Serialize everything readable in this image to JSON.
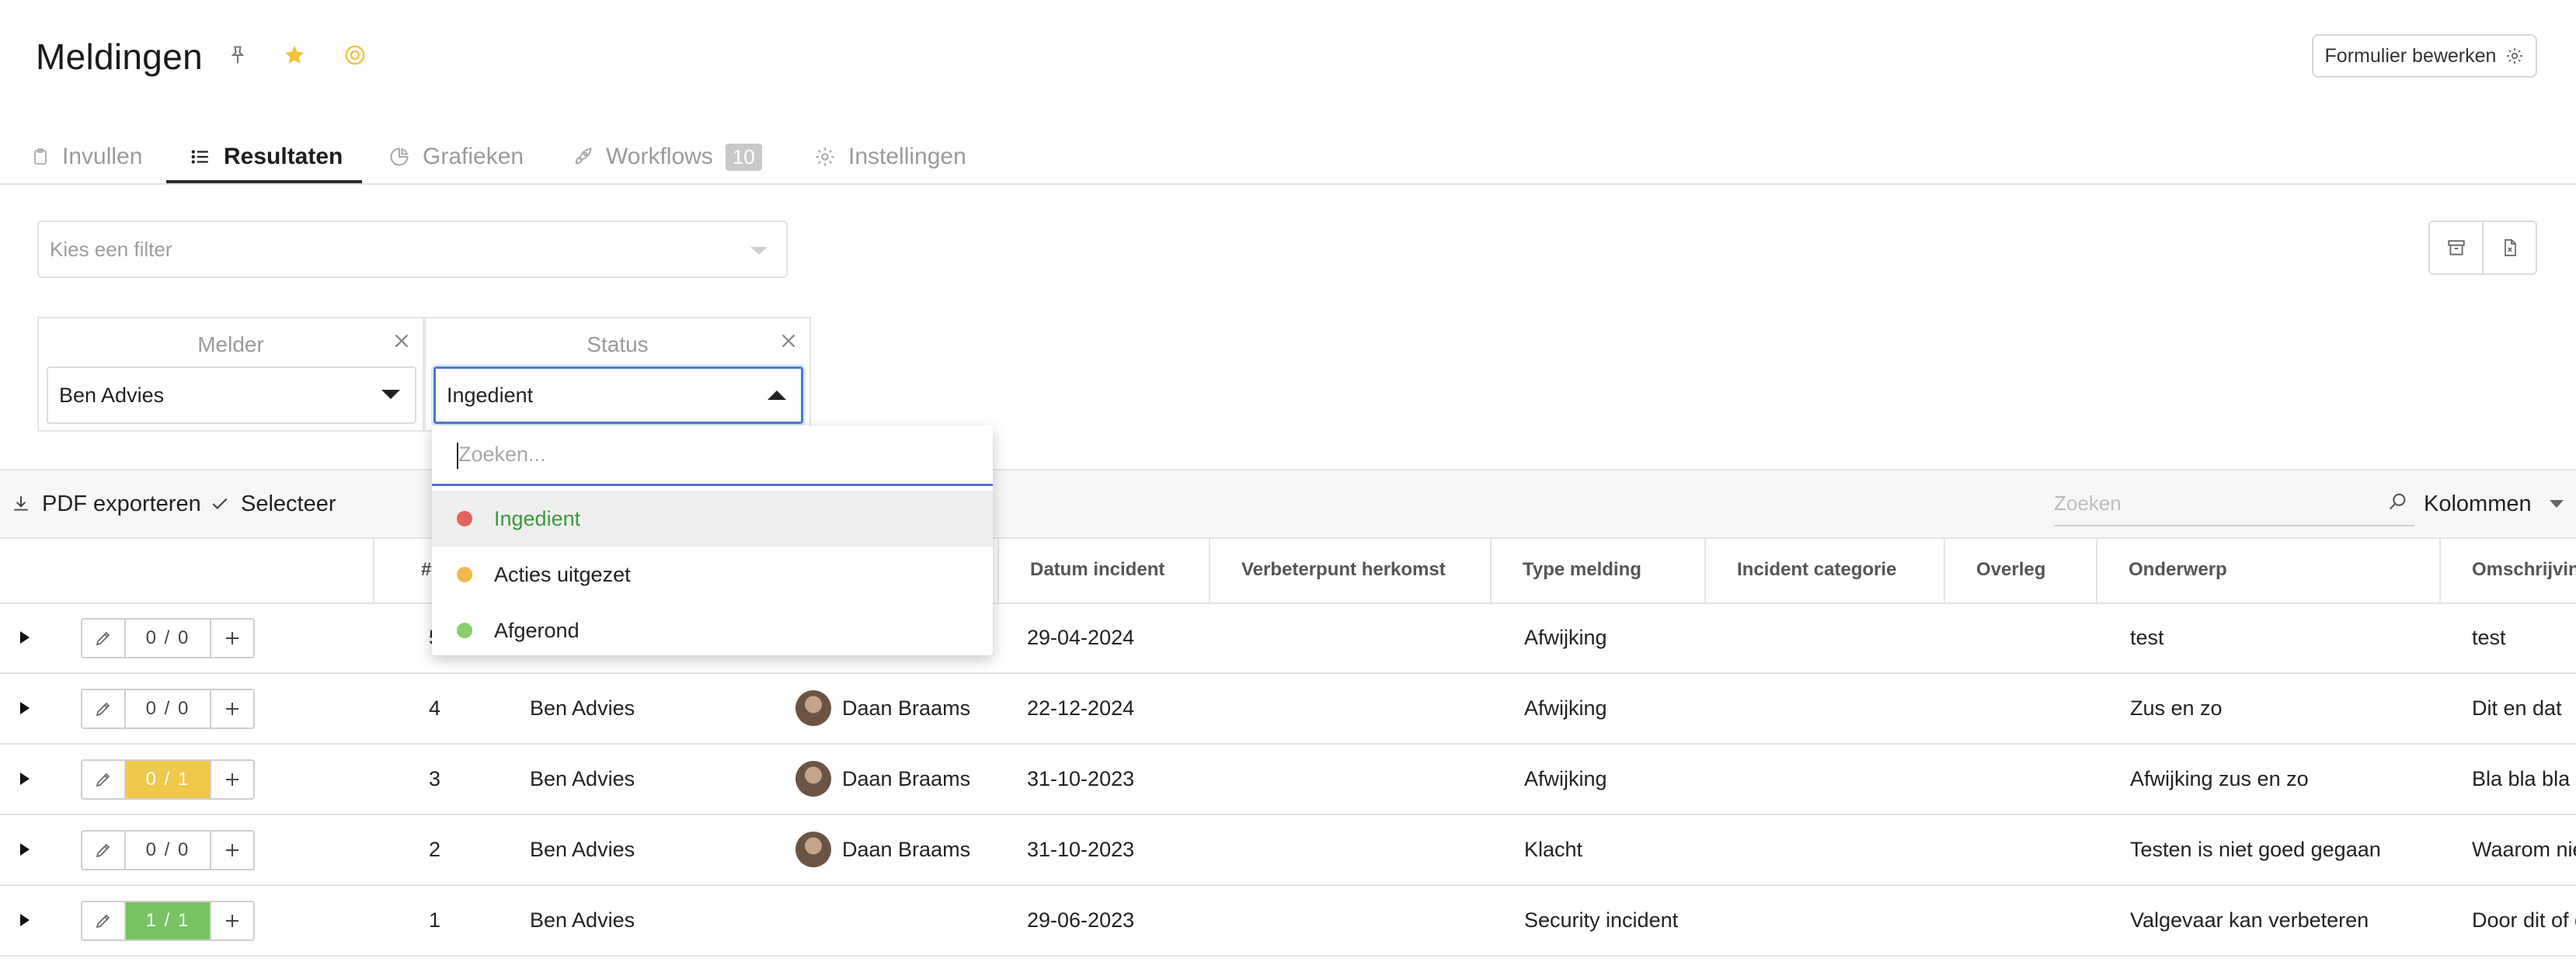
{
  "header": {
    "title": "Meldingen",
    "edit_form_label": "Formulier bewerken"
  },
  "tabs": [
    {
      "label": "Invullen",
      "icon": "clipboard-icon"
    },
    {
      "label": "Resultaten",
      "icon": "list-icon",
      "active": true
    },
    {
      "label": "Grafieken",
      "icon": "pie-chart-icon"
    },
    {
      "label": "Workflows",
      "icon": "rocket-icon",
      "badge": "10"
    },
    {
      "label": "Instellingen",
      "icon": "gear-icon"
    }
  ],
  "filter": {
    "placeholder": "Kies een filter"
  },
  "facets": [
    {
      "title": "Melder",
      "value": "Ben Advies"
    },
    {
      "title": "Status",
      "value": "Ingedient"
    }
  ],
  "dropdown": {
    "search_placeholder": "Zoeken...",
    "options": [
      {
        "label": "Ingedient",
        "color": "#e0645c",
        "selected": true
      },
      {
        "label": "Acties uitgezet",
        "color": "#f1b94a"
      },
      {
        "label": "Afgerond",
        "color": "#8ccd6b"
      }
    ]
  },
  "toolbar": {
    "pdf_export_label": "PDF exporteren",
    "select_label": "Selecteer",
    "search_placeholder": "Zoeken",
    "columns_label": "Kolommen"
  },
  "table": {
    "columns": [
      "#",
      "Datum incident",
      "Verbeterpunt herkomst",
      "Type melding",
      "Incident categorie",
      "Overleg",
      "Onderwerp",
      "Omschrijving"
    ],
    "rows": [
      {
        "counter": "0 / 0",
        "counter_state": "none",
        "id": "5",
        "melder": "",
        "person": "",
        "date": "29-04-2024",
        "type": "Afwijking",
        "subject": "test",
        "description": "test"
      },
      {
        "counter": "0 / 0",
        "counter_state": "none",
        "id": "4",
        "melder": "Ben Advies",
        "person": "Daan Braams",
        "date": "22-12-2024",
        "type": "Afwijking",
        "subject": "Zus en zo",
        "description": "Dit en dat"
      },
      {
        "counter": "0 / 1",
        "counter_state": "warn",
        "id": "3",
        "melder": "Ben Advies",
        "person": "Daan Braams",
        "date": "31-10-2023",
        "type": "Afwijking",
        "subject": "Afwijking zus en zo",
        "description": "Bla bla bla"
      },
      {
        "counter": "0 / 0",
        "counter_state": "none",
        "id": "2",
        "melder": "Ben Advies",
        "person": "Daan Braams",
        "date": "31-10-2023",
        "type": "Klacht",
        "subject": "Testen is niet goed gegaan",
        "description": "Waarom nie"
      },
      {
        "counter": "1 / 1",
        "counter_state": "ok",
        "id": "1",
        "melder": "Ben Advies",
        "person": "",
        "date": "29-06-2023",
        "type": "Security incident",
        "subject": "Valgevaar kan verbeteren",
        "description": "Door dit of d"
      }
    ]
  },
  "colors": {
    "accent_blue": "#4a7bd6",
    "warn_yellow": "#efc94b",
    "ok_green": "#79c263",
    "star": "#f0c236"
  }
}
